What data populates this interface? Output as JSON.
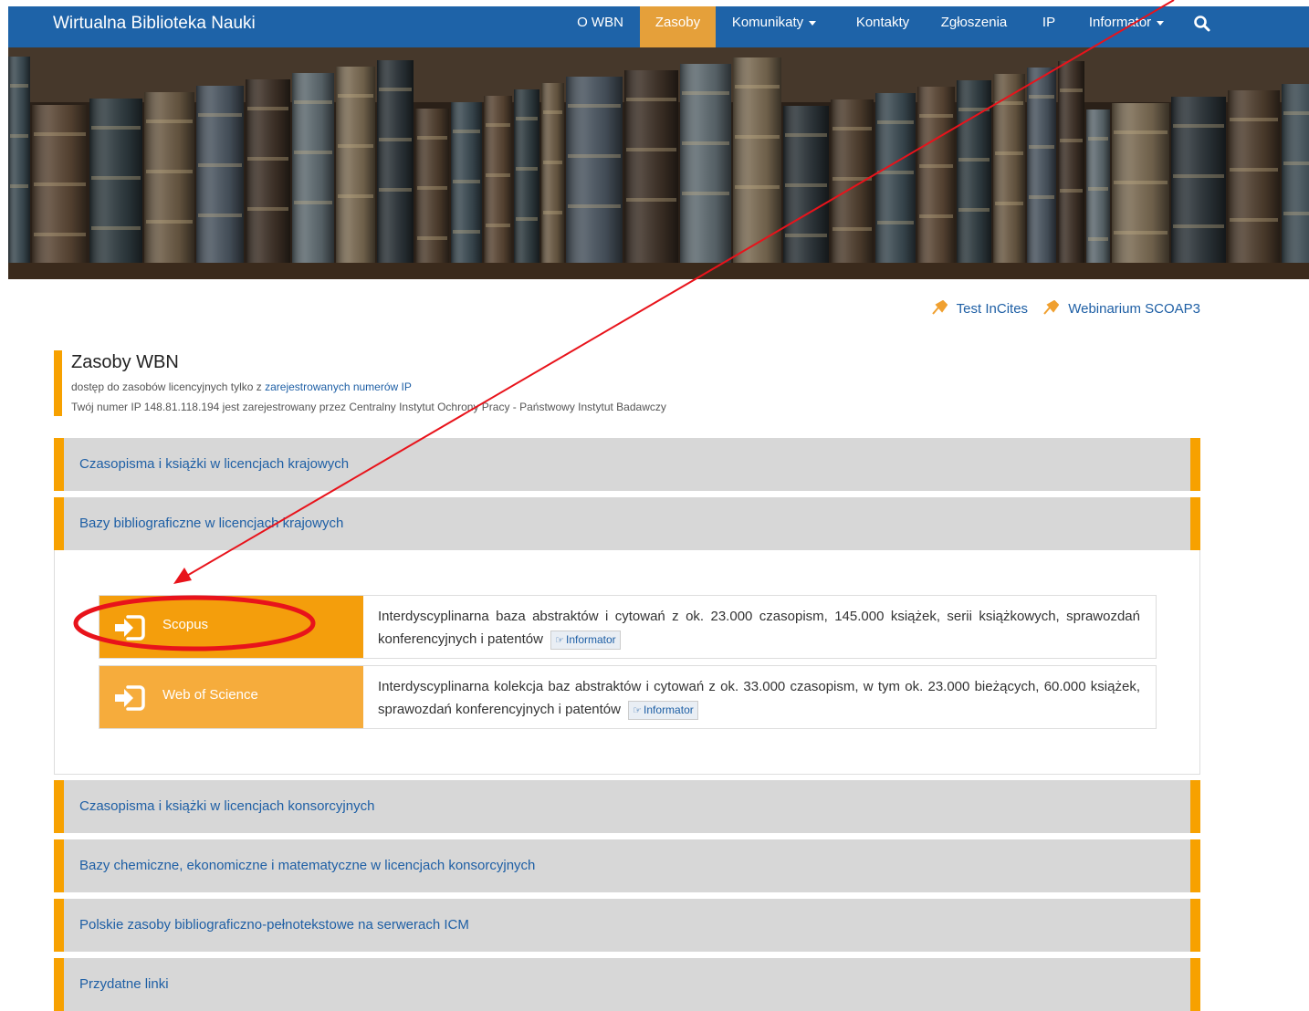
{
  "navbar": {
    "brand": "Wirtualna Biblioteka Nauki",
    "items": [
      {
        "label": "O WBN"
      },
      {
        "label": "Zasoby",
        "active": true
      },
      {
        "label": "Komunikaty",
        "dropdown": true
      },
      {
        "label": "Kontakty"
      },
      {
        "label": "Zgłoszenia"
      },
      {
        "label": "IP"
      },
      {
        "label": "Informator",
        "dropdown": true
      }
    ],
    "search_icon": "search-icon",
    "colors": {
      "bar": "#1e63a8",
      "active": "#e5a03a"
    }
  },
  "pins": [
    {
      "label": "Test InCites",
      "icon": "pin-icon"
    },
    {
      "label": "Webinarium SCOAP3",
      "icon": "pin-icon"
    }
  ],
  "section": {
    "title": "Zasoby WBN",
    "subtitle_prefix": "dostęp do zasobów licencyjnych tylko z",
    "subtitle_link": "zarejestrowanych numerów IP",
    "ip_note": "Twój numer IP 148.81.118.194 jest zarejestrowany przez Centralny Instytut Ochrony Pracy - Państwowy Instytut Badawczy",
    "accent": "#f7a100"
  },
  "panels": [
    {
      "title": "Czasopisma i książki w licencjach krajowych"
    },
    {
      "title": "Bazy bibliograficzne w licencjach krajowych",
      "expanded": true
    },
    {
      "title": "Czasopisma i książki w licencjach konsorcyjnych"
    },
    {
      "title": "Bazy chemiczne, ekonomiczne i matematyczne w licencjach konsorcyjnych"
    },
    {
      "title": "Polskie zasoby bibliograficzno-pełnotekstowe na serwerach ICM"
    },
    {
      "title": "Przydatne linki"
    }
  ],
  "resources": [
    {
      "name": "Scopus",
      "icon": "sign-in-icon",
      "description": "Interdyscyplinarna baza abstraktów i cytowań z ok. 23.000 czasopism, 145.000 książek, serii książkowych, sprawozdań konferencyjnych i patentów",
      "badge": "Informator",
      "highlighted": true
    },
    {
      "name": "Web of Science",
      "icon": "sign-in-icon",
      "description": "Interdyscyplinarna kolekcja baz abstraktów i cytowań z ok. 33.000 czasopism, w tym ok. 23.000 bieżących, 60.000 książek, sprawozdań konferencyjnych i patentów",
      "badge": "Informator"
    }
  ],
  "annotation": {
    "arrow_color": "#e8131b",
    "ellipse_color": "#e8131b"
  }
}
